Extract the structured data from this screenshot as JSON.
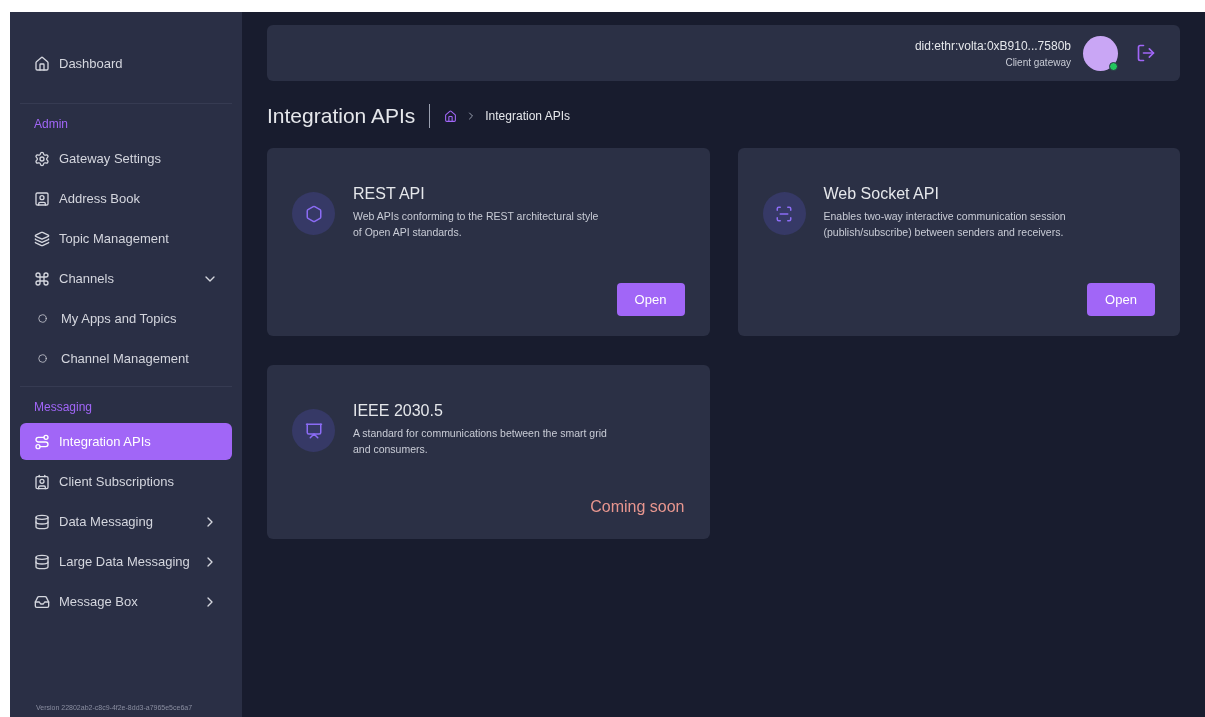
{
  "sidebar": {
    "sections": [
      {
        "items": [
          {
            "label": "Dashboard",
            "kind": "item",
            "selected": false
          }
        ]
      },
      {
        "heading": "Admin",
        "items": [
          {
            "label": "Gateway Settings",
            "kind": "item",
            "selected": false
          },
          {
            "label": "Address Book",
            "kind": "item",
            "selected": false
          },
          {
            "label": "Topic Management",
            "kind": "item",
            "selected": false
          },
          {
            "label": "Channels",
            "kind": "item",
            "selected": false,
            "expanded": true
          },
          {
            "label": "My Apps and Topics",
            "kind": "sub",
            "selected": false
          },
          {
            "label": "Channel Management",
            "kind": "sub",
            "selected": false
          }
        ]
      },
      {
        "heading": "Messaging",
        "items": [
          {
            "label": "Integration APIs",
            "kind": "item",
            "selected": true
          },
          {
            "label": "Client Subscriptions",
            "kind": "item",
            "selected": false
          },
          {
            "label": "Data Messaging",
            "kind": "item",
            "selected": false,
            "expanded": false
          },
          {
            "label": "Large Data Messaging",
            "kind": "item",
            "selected": false,
            "expanded": false
          },
          {
            "label": "Message Box",
            "kind": "item",
            "selected": false,
            "expanded": false
          }
        ]
      }
    ],
    "version": "Version 22802ab2-c8c9-4f2e-8dd3-a7965e5ce6a7"
  },
  "header": {
    "user_id": "did:ethr:volta:0xB910...7580b",
    "role": "Client gateway",
    "online": true
  },
  "page": {
    "title": "Integration APIs",
    "breadcrumb": [
      "Integration APIs"
    ]
  },
  "cards": [
    {
      "title": "REST API",
      "description": "Web APIs conforming to the REST architectural style of Open API standards.",
      "action": {
        "kind": "button",
        "label": "Open"
      }
    },
    {
      "title": "Web Socket API",
      "description": "Enables two-way interactive communication session (publish/subscribe) between senders and receivers.",
      "action": {
        "kind": "button",
        "label": "Open"
      }
    },
    {
      "title": "IEEE 2030.5",
      "description": "A standard for communications between the smart grid and consumers.",
      "action": {
        "kind": "status",
        "label": "Coming soon"
      }
    }
  ]
}
